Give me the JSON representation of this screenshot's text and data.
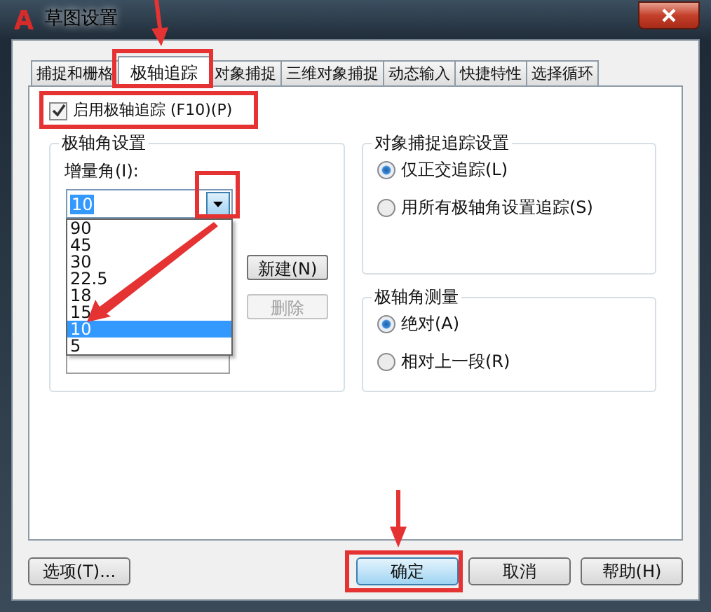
{
  "window": {
    "title": "草图设置"
  },
  "tabs": [
    {
      "label": "捕捉和栅格",
      "selected": false
    },
    {
      "label": "极轴追踪",
      "selected": true
    },
    {
      "label": "对象捕捉",
      "selected": false
    },
    {
      "label": "三维对象捕捉",
      "selected": false
    },
    {
      "label": "动态输入",
      "selected": false
    },
    {
      "label": "快捷特性",
      "selected": false
    },
    {
      "label": "选择循环",
      "selected": false
    }
  ],
  "enable_checkbox": {
    "label": "启用极轴追踪 (F10)(P)",
    "checked": true
  },
  "polar_angle_group": {
    "title": "极轴角设置",
    "increment_label": "增量角(I):",
    "increment_value": "10",
    "dropdown_options": [
      {
        "label": "90",
        "selected": false
      },
      {
        "label": "45",
        "selected": false
      },
      {
        "label": "30",
        "selected": false
      },
      {
        "label": "22.5",
        "selected": false
      },
      {
        "label": "18",
        "selected": false
      },
      {
        "label": "15",
        "selected": false
      },
      {
        "label": "10",
        "selected": true
      },
      {
        "label": "5",
        "selected": false
      }
    ],
    "buttons": [
      {
        "label": "新建(N)",
        "disabled": false
      },
      {
        "label": "删除",
        "disabled": true
      }
    ]
  },
  "tracking_group": {
    "title": "对象捕捉追踪设置",
    "options": [
      {
        "label": "仅正交追踪(L)",
        "selected": true
      },
      {
        "label": "用所有极轴角设置追踪(S)",
        "selected": false
      }
    ]
  },
  "measure_group": {
    "title": "极轴角测量",
    "options": [
      {
        "label": "绝对(A)",
        "selected": true
      },
      {
        "label": "相对上一段(R)",
        "selected": false
      }
    ]
  },
  "footer_buttons": [
    {
      "label": "选项(T)...",
      "default": false
    },
    {
      "label": "确定",
      "default": true
    },
    {
      "label": "取消",
      "default": false
    },
    {
      "label": "帮助(H)",
      "default": false
    }
  ]
}
